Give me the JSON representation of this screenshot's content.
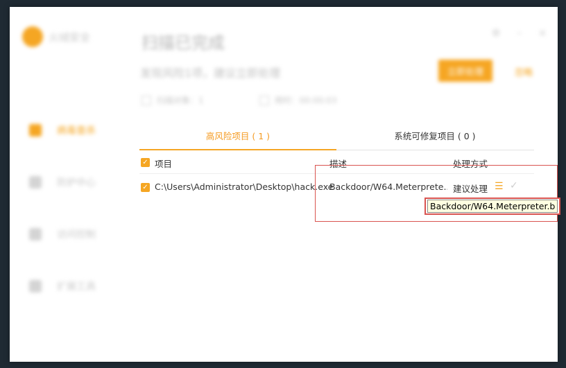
{
  "app": {
    "name": "火绒安全",
    "window_controls": [
      "⚙",
      "–",
      "×"
    ]
  },
  "sidebar": {
    "items": [
      {
        "label": "病毒查杀"
      },
      {
        "label": "防护中心"
      },
      {
        "label": "访问控制"
      },
      {
        "label": "扩展工具"
      }
    ]
  },
  "header": {
    "title": "扫描已完成",
    "subtitle": "发现风险1项，建议立即处理",
    "repair_button": "立即处理",
    "ignore_link": "忽略",
    "stats": [
      "扫描对象：1",
      "用时：00:00:03"
    ]
  },
  "tabs": [
    {
      "label": "高风险项目 ( 1 )",
      "active": true
    },
    {
      "label": "系统可修复项目 ( 0 )",
      "active": false
    }
  ],
  "table": {
    "columns": [
      "项目",
      "描述",
      "处理方式"
    ],
    "rows": [
      {
        "path": "C:\\Users\\Administrator\\Desktop\\hack.exe",
        "description": "Backdoor/W64.Meterprete...",
        "action": "建议处理"
      }
    ]
  },
  "tooltip": {
    "text": "Backdoor/W64.Meterpreter.b"
  },
  "colors": {
    "accent": "#f5a623",
    "highlight": "#d9534f"
  }
}
